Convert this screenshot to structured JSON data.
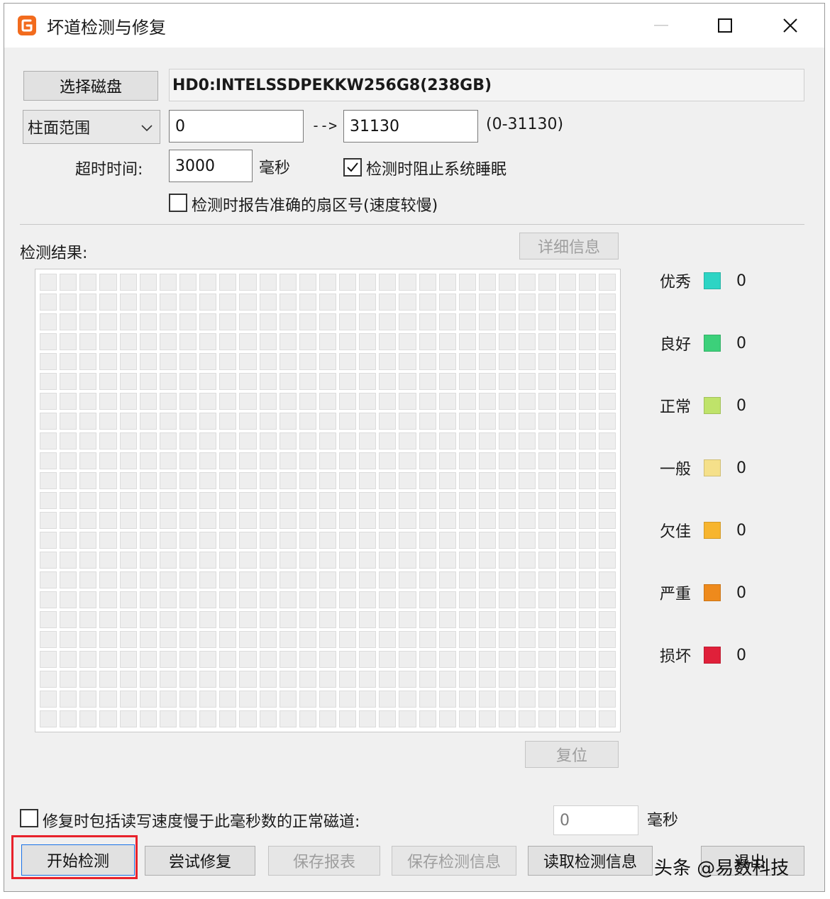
{
  "window": {
    "title": "坏道检测与修复",
    "icon": "app-logo-icon"
  },
  "disk": {
    "select_button": "选择磁盘",
    "name": "HD0:INTELSSDPEKKW256G8(238GB)"
  },
  "range": {
    "mode": "柱面范围",
    "start": "0",
    "arrow": "-->",
    "end": "31130",
    "hint": "(0-31130)"
  },
  "timeout": {
    "label": "超时时间:",
    "value": "3000",
    "unit": "毫秒"
  },
  "options": {
    "prevent_sleep": {
      "label": "检测时阻止系统睡眠",
      "checked": true
    },
    "report_sector": {
      "label": "检测时报告准确的扇区号(速度较慢)",
      "checked": false
    }
  },
  "results": {
    "label": "检测结果:",
    "details_button": "详细信息",
    "reset_button": "复位"
  },
  "legend": [
    {
      "label": "优秀",
      "color": "#2dd4c4",
      "count": "0"
    },
    {
      "label": "良好",
      "color": "#3cd07a",
      "count": "0"
    },
    {
      "label": "正常",
      "color": "#bfe36a",
      "count": "0"
    },
    {
      "label": "一般",
      "color": "#f5e08a",
      "count": "0"
    },
    {
      "label": "欠佳",
      "color": "#f7b52f",
      "count": "0"
    },
    {
      "label": "严重",
      "color": "#ee8a1c",
      "count": "0"
    },
    {
      "label": "损坏",
      "color": "#e0203a",
      "count": "0"
    }
  ],
  "repair_option": {
    "label": "修复时包括读写速度慢于此毫秒数的正常磁道:",
    "checked": false,
    "value": "0",
    "unit": "毫秒"
  },
  "actions": {
    "start": "开始检测",
    "repair": "尝试修复",
    "save_report": "保存报表",
    "save_info": "保存检测信息",
    "load_info": "读取检测信息",
    "exit": "退出"
  },
  "watermark": "头条 @易数科技",
  "colors": {
    "highlight": "#e8222b",
    "app_icon": "#f26b1d"
  }
}
